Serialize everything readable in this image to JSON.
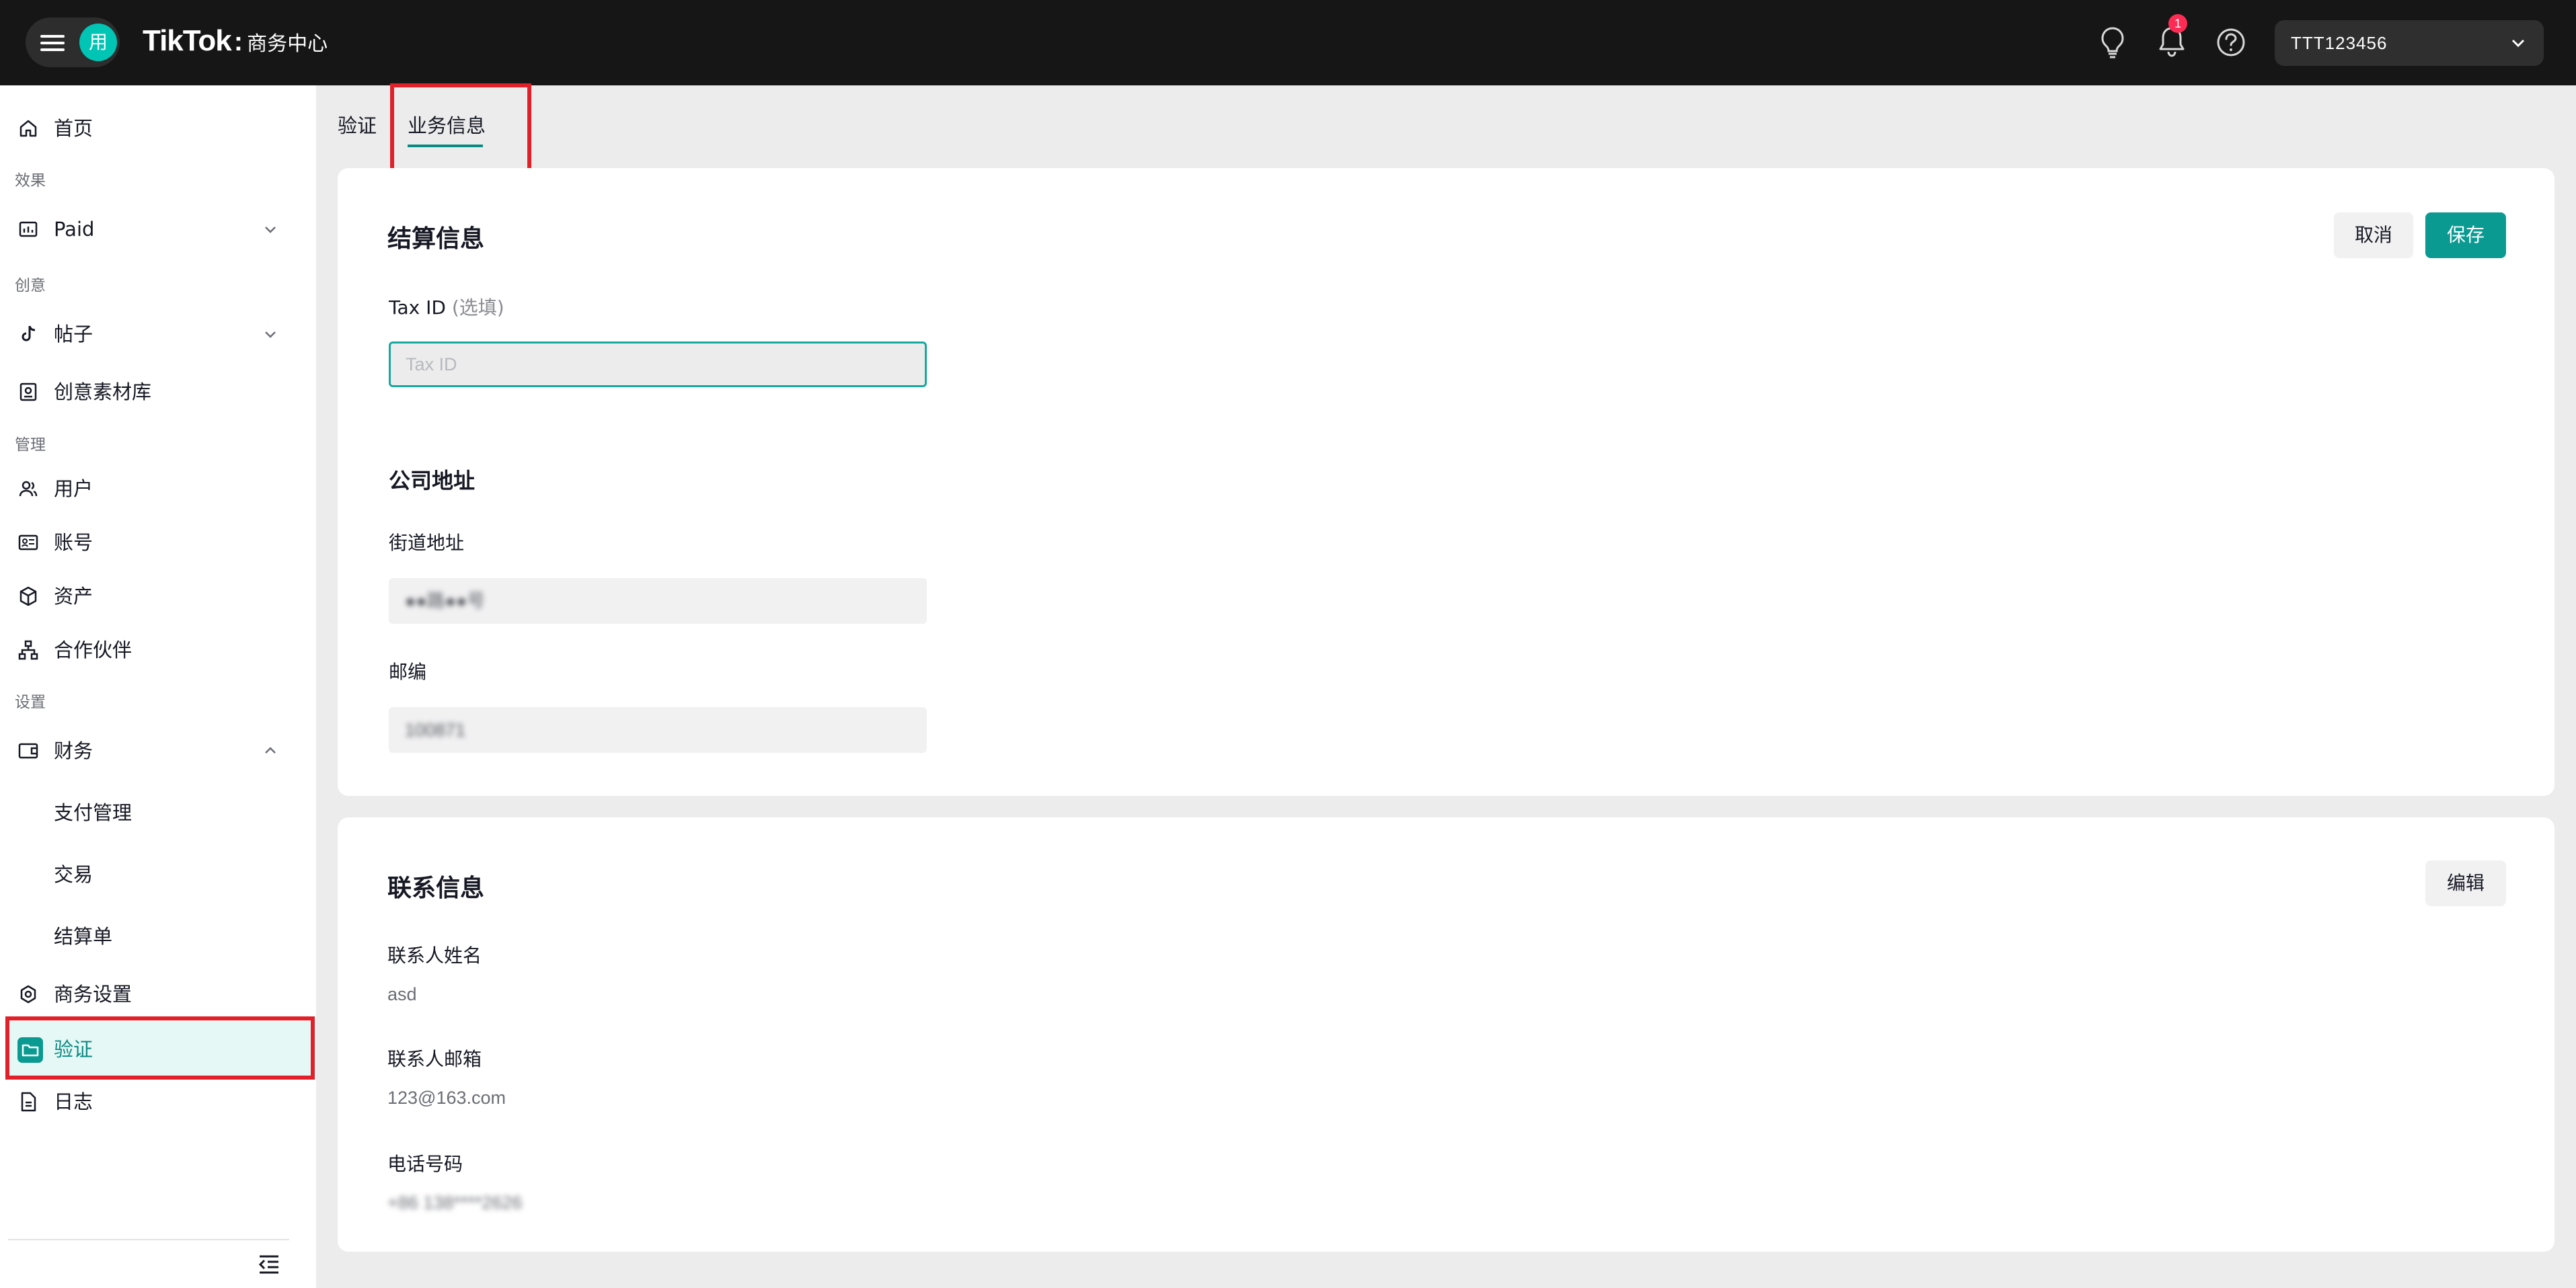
{
  "topbar": {
    "app_avatar": "用",
    "logo_word": "TikTok",
    "logo_sub": "商务中心",
    "notification_count": "1",
    "account_name": "TTT123456",
    "icons": [
      "menu-icon",
      "lightbulb-icon",
      "bell-icon",
      "help-icon",
      "chevron-down-icon"
    ]
  },
  "sidebar": {
    "home": "首页",
    "section_effect": "效果",
    "paid": "Paid",
    "section_creative": "创意",
    "posts": "帖子",
    "creative_library": "创意素材库",
    "section_manage": "管理",
    "users": "用户",
    "accounts": "账号",
    "assets": "资产",
    "partners": "合作伙伴",
    "section_settings": "设置",
    "finance": "财务",
    "payment_management": "支付管理",
    "transactions": "交易",
    "statements": "结算单",
    "business_settings": "商务设置",
    "verification": "验证",
    "logs": "日志"
  },
  "tabs": {
    "verification": "验证",
    "business_info": "业务信息"
  },
  "billing": {
    "title": "结算信息",
    "cancel": "取消",
    "save": "保存",
    "tax_label": "Tax ID",
    "tax_optional": "(选填)",
    "tax_placeholder": "Tax ID",
    "address_title": "公司地址",
    "street_label": "街道地址",
    "street_value": "●●路●●号",
    "zip_label": "邮编",
    "zip_value": "100871"
  },
  "contact": {
    "title": "联系信息",
    "edit": "编辑",
    "name_label": "联系人姓名",
    "name_value": "asd",
    "email_label": "联系人邮箱",
    "email_value": "123@163.com",
    "phone_label": "电话号码",
    "phone_value": "+86 138****2626"
  },
  "colors": {
    "accent": "#0a9a92",
    "highlight": "#e1202a",
    "topbar": "#161616"
  }
}
